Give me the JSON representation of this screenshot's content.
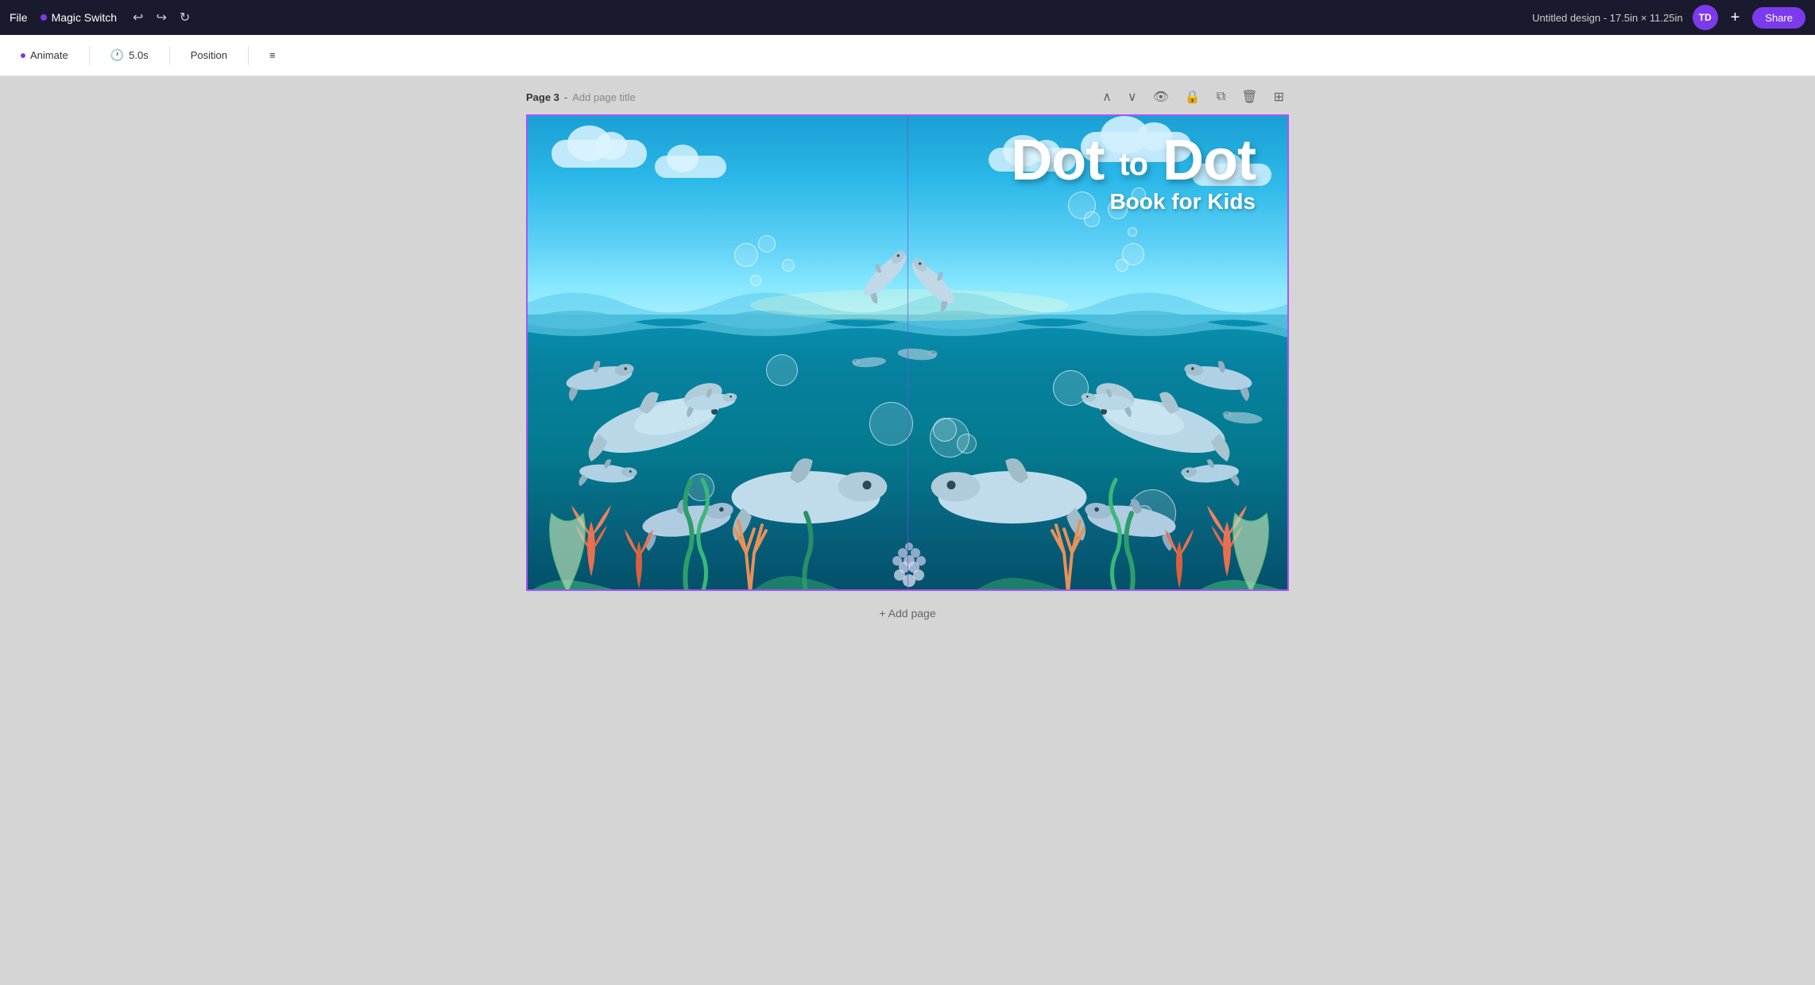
{
  "topbar": {
    "file_label": "File",
    "magic_switch_label": "Magic Switch",
    "design_title": "Untitled design - 17.5in × 11.25in",
    "user_initials": "TD",
    "share_label": "Share"
  },
  "toolbar": {
    "animate_label": "Animate",
    "duration_label": "5.0s",
    "position_label": "Position"
  },
  "page": {
    "page_label": "Page 3",
    "separator": "-",
    "add_title_label": "Add page title"
  },
  "canvas": {
    "title_main_left": "Dot",
    "title_to": "to",
    "title_main_right": "Dot",
    "title_subtitle": "Book for Kids"
  },
  "add_page": {
    "label": "+ Add page"
  }
}
